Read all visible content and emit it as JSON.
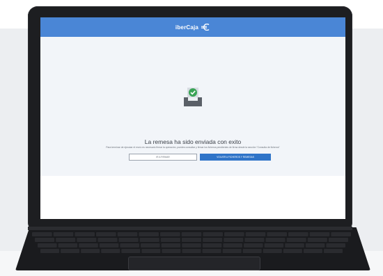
{
  "header": {
    "logo_text": "iberCaja"
  },
  "main": {
    "status_icon": "upload-success-icon",
    "title": "La remesa ha sido enviada con exito",
    "subtitle": "Para terminar de ejecutar el envío es necesario firmar la operación, puedes consultar y firmar los ficheros pendientes de firma desde la sección \"Consulta de ficheros\"",
    "secondary_button": "Ir a firmar",
    "primary_button": "Volver a ficheros y remesas"
  },
  "colors": {
    "brand_blue": "#4a86d6",
    "primary_button": "#2f74c8",
    "success_green": "#3aa356",
    "content_background": "#f2f5f9"
  }
}
